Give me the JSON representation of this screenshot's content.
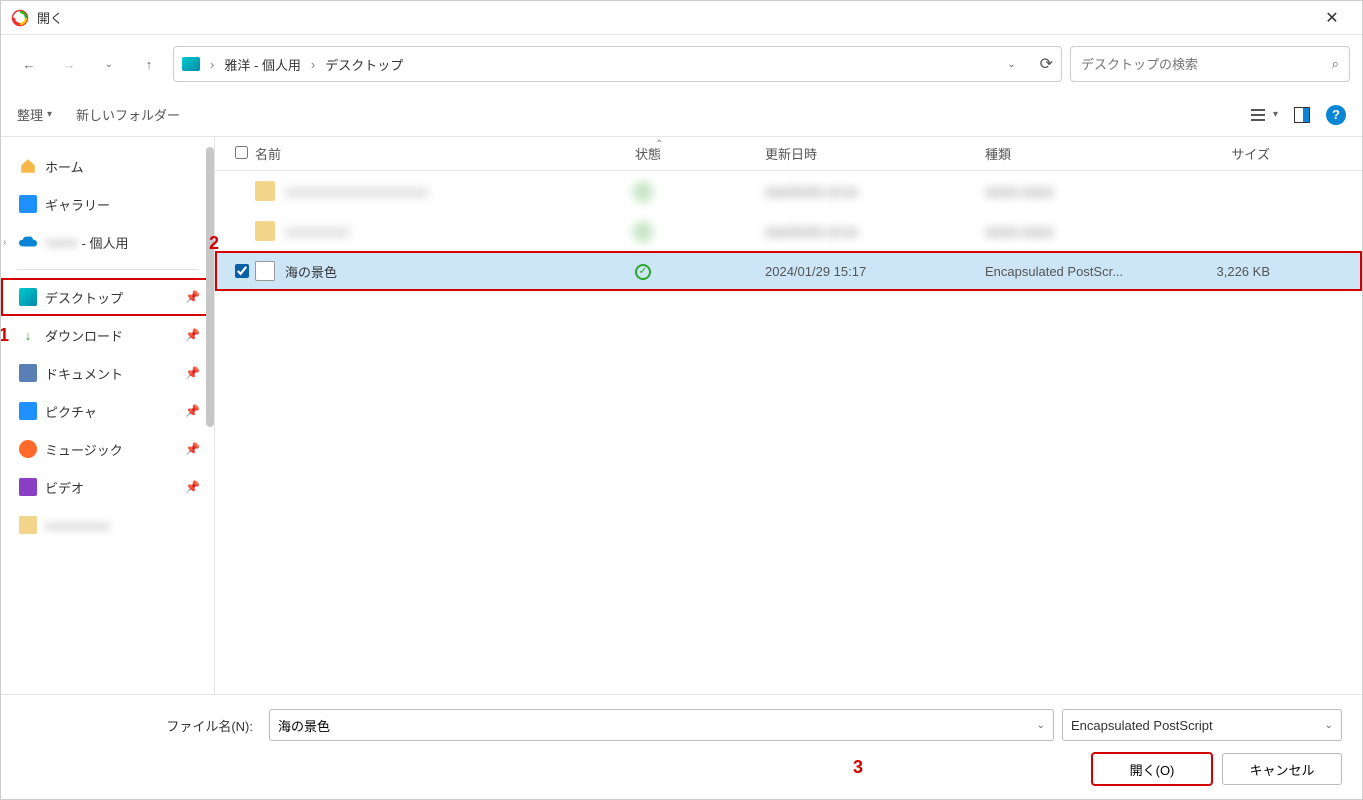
{
  "title": "開く",
  "breadcrumbs": {
    "root": "雅洋 - 個人用",
    "folder": "デスクトップ"
  },
  "search": {
    "placeholder": "デスクトップの検索"
  },
  "toolbar": {
    "organize": "整理",
    "new_folder": "新しいフォルダー"
  },
  "sidebar": {
    "home": "ホーム",
    "gallery": "ギャラリー",
    "onedrive": "- 個人用",
    "desktop": "デスクトップ",
    "downloads": "ダウンロード",
    "documents": "ドキュメント",
    "pictures": "ピクチャ",
    "music": "ミュージック",
    "videos": "ビデオ"
  },
  "columns": {
    "name": "名前",
    "state": "状態",
    "date": "更新日時",
    "type": "種類",
    "size": "サイズ"
  },
  "files": {
    "selected": {
      "name": "海の景色",
      "date": "2024/01/29 15:17",
      "type": "Encapsulated PostScr...",
      "size": "3,226 KB"
    }
  },
  "footer": {
    "filename_label": "ファイル名(N):",
    "filename_value": "海の景色",
    "filter": "Encapsulated PostScript",
    "open": "開く(O)",
    "cancel": "キャンセル"
  },
  "annotations": {
    "a1": "1",
    "a2": "2",
    "a3": "3"
  }
}
